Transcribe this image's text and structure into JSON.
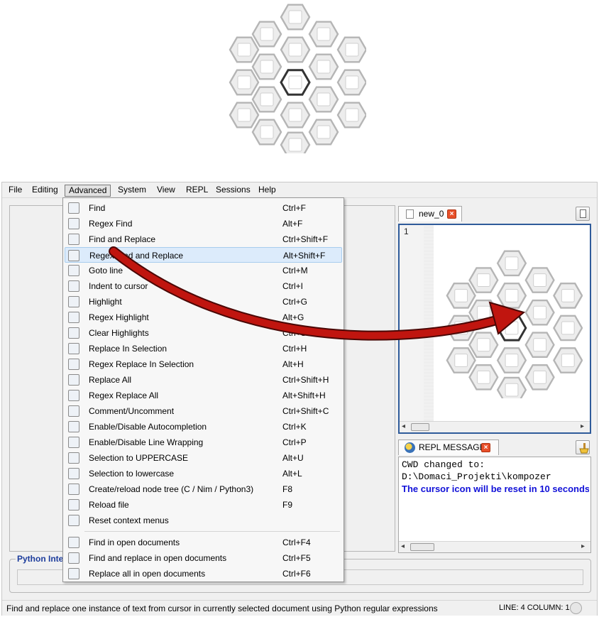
{
  "menubar": {
    "items": [
      "File",
      "Editing",
      "Advanced",
      "System",
      "View",
      "REPL",
      "Sessions",
      "Help"
    ]
  },
  "advanced_menu": {
    "items": [
      {
        "label": "Find",
        "shortcut": "Ctrl+F",
        "icon": "find-icon"
      },
      {
        "label": "Regex Find",
        "shortcut": "Alt+F",
        "icon": "regex-find-icon"
      },
      {
        "label": "Find and Replace",
        "shortcut": "Ctrl+Shift+F",
        "icon": "find-replace-icon"
      },
      {
        "label": "Regex Find and Replace",
        "shortcut": "Alt+Shift+F",
        "icon": "regex-find-replace-icon"
      },
      {
        "label": "Goto line",
        "shortcut": "Ctrl+M",
        "icon": "goto-line-icon"
      },
      {
        "label": "Indent to cursor",
        "shortcut": "Ctrl+I",
        "icon": "indent-icon"
      },
      {
        "label": "Highlight",
        "shortcut": "Ctrl+G",
        "icon": "highlight-icon"
      },
      {
        "label": "Regex Highlight",
        "shortcut": "Alt+G",
        "icon": "regex-highlight-icon"
      },
      {
        "label": "Clear Highlights",
        "shortcut": "Ctrl+Shift+G",
        "icon": "clear-highlights-icon"
      },
      {
        "label": "Replace In Selection",
        "shortcut": "Ctrl+H",
        "icon": "replace-selection-icon"
      },
      {
        "label": "Regex Replace In Selection",
        "shortcut": "Alt+H",
        "icon": "regex-replace-selection-icon"
      },
      {
        "label": "Replace All",
        "shortcut": "Ctrl+Shift+H",
        "icon": "replace-all-icon"
      },
      {
        "label": "Regex Replace All",
        "shortcut": "Alt+Shift+H",
        "icon": "regex-replace-all-icon"
      },
      {
        "label": "Comment/Uncomment",
        "shortcut": "Ctrl+Shift+C",
        "icon": "comment-icon"
      },
      {
        "label": "Enable/Disable Autocompletion",
        "shortcut": "Ctrl+K",
        "icon": "autocompletion-icon"
      },
      {
        "label": "Enable/Disable Line Wrapping",
        "shortcut": "Ctrl+P",
        "icon": "line-wrap-icon"
      },
      {
        "label": "Selection to UPPERCASE",
        "shortcut": "Alt+U",
        "icon": "uppercase-icon"
      },
      {
        "label": "Selection to lowercase",
        "shortcut": "Alt+L",
        "icon": "lowercase-icon"
      },
      {
        "label": "Create/reload node tree (C / Nim / Python3)",
        "shortcut": "F8",
        "icon": "node-tree-icon"
      },
      {
        "label": "Reload file",
        "shortcut": "F9",
        "icon": "reload-icon"
      },
      {
        "label": "Reset context menus",
        "shortcut": "",
        "icon": "reset-menus-icon"
      },
      {
        "label": "Find in open documents",
        "shortcut": "Ctrl+F4",
        "icon": "find-open-docs-icon"
      },
      {
        "label": "Find and replace in open documents",
        "shortcut": "Ctrl+F5",
        "icon": "find-replace-open-docs-icon"
      },
      {
        "label": "Replace all in open documents",
        "shortcut": "Ctrl+F6",
        "icon": "replace-all-open-docs-icon"
      }
    ]
  },
  "editor": {
    "tab_label": "new_0",
    "line_number": "1"
  },
  "repl": {
    "tab_label": "REPL MESSAGES",
    "lines": [
      "CWD changed to:",
      "D:\\Domaci_Projekti\\kompozer",
      "The cursor icon will be reset in 10 seconds"
    ]
  },
  "python_group": {
    "title": "Python Interpreter"
  },
  "statusbar": {
    "message": "Find and replace one instance of text from cursor in currently selected document using Python regular expressions",
    "position": "LINE: 4 COLUMN: 1"
  },
  "colors": {
    "highlight": "#dcebfb",
    "arrow": "#c0150f",
    "accent_blue": "#1111d8",
    "frame_blue": "#2f5b9a"
  }
}
